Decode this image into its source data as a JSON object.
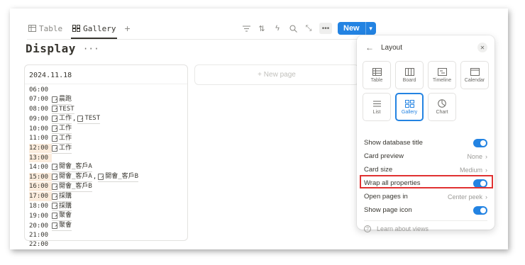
{
  "tabs": [
    {
      "label": "Table",
      "icon": "table-icon"
    },
    {
      "label": "Gallery",
      "icon": "gallery-icon"
    }
  ],
  "toolbar": {
    "new_label": "New",
    "icons": [
      "filter-icon",
      "sort-icon",
      "automation-icon",
      "search-icon",
      "expand-icon",
      "more-icon"
    ]
  },
  "page": {
    "title": "Display",
    "title_menu": "···"
  },
  "card": {
    "date": "2024.11.18",
    "rows": [
      {
        "time": "06:00",
        "highlight": false,
        "events": []
      },
      {
        "time": "07:00",
        "highlight": false,
        "events": [
          "晨跑"
        ]
      },
      {
        "time": "08:00",
        "highlight": false,
        "events": [
          "TEST"
        ]
      },
      {
        "time": "09:00",
        "highlight": false,
        "events": [
          "工作",
          "TEST"
        ]
      },
      {
        "time": "10:00",
        "highlight": false,
        "events": [
          "工作"
        ]
      },
      {
        "time": "11:00",
        "highlight": false,
        "events": [
          "工作"
        ]
      },
      {
        "time": "12:00",
        "highlight": true,
        "events": [
          "工作"
        ]
      },
      {
        "time": "13:00",
        "highlight": true,
        "events": []
      },
      {
        "time": "14:00",
        "highlight": false,
        "events": [
          "開會_客戶A"
        ]
      },
      {
        "time": "15:00",
        "highlight": true,
        "events": [
          "開會_客戶A",
          "開會_客戶B"
        ]
      },
      {
        "time": "16:00",
        "highlight": true,
        "events": [
          "開會_客戶B"
        ]
      },
      {
        "time": "17:00",
        "highlight": true,
        "events": [
          "採購"
        ]
      },
      {
        "time": "18:00",
        "highlight": false,
        "events": [
          "採購"
        ]
      },
      {
        "time": "19:00",
        "highlight": false,
        "events": [
          "聚會"
        ]
      },
      {
        "time": "20:00",
        "highlight": false,
        "events": [
          "聚會"
        ]
      },
      {
        "time": "21:00",
        "highlight": false,
        "events": []
      },
      {
        "time": "22:00",
        "highlight": false,
        "events": []
      }
    ]
  },
  "new_page_label": "+ New page",
  "layout_panel": {
    "title": "Layout",
    "options": [
      {
        "label": "Table",
        "icon": "table-icon",
        "selected": false
      },
      {
        "label": "Board",
        "icon": "board-icon",
        "selected": false
      },
      {
        "label": "Timeline",
        "icon": "timeline-icon",
        "selected": false
      },
      {
        "label": "Calendar",
        "icon": "calendar-icon",
        "selected": false
      },
      {
        "label": "List",
        "icon": "list-icon",
        "selected": false
      },
      {
        "label": "Gallery",
        "icon": "gallery-icon",
        "selected": true
      },
      {
        "label": "Chart",
        "icon": "chart-icon",
        "selected": false
      }
    ],
    "settings": {
      "show_database_title": "Show database title",
      "card_preview": "Card preview",
      "card_preview_value": "None",
      "card_size": "Card size",
      "card_size_value": "Medium",
      "wrap_all_properties": "Wrap all properties",
      "open_pages_in": "Open pages in",
      "open_pages_in_value": "Center peek",
      "show_page_icon": "Show page icon"
    },
    "learn_label": "Learn about views"
  },
  "colors": {
    "accent": "#2383e2",
    "highlight_box": "#e03131",
    "time_highlight": "#fbecdd"
  }
}
